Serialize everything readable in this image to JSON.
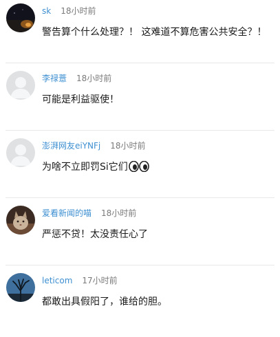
{
  "comments": [
    {
      "username": "sk",
      "time": "18小时前",
      "content": "警告算个什么处理？！ 这难道不算危害公共安全？！",
      "avatar_icon": "night-scene-avatar"
    },
    {
      "username": "李禄薏",
      "time": "18小时前",
      "content": "可能是利益驱使！",
      "avatar_icon": "default-user-avatar"
    },
    {
      "username": "澎湃网友eiYNFj",
      "time": "18小时前",
      "content": "为啥不立即罚Si它们",
      "emoji": "eyes-emoji",
      "avatar_icon": "default-user-avatar"
    },
    {
      "username": "爱看新闻的喵",
      "time": "18小时前",
      "content": "严惩不贷！太没责任心了",
      "avatar_icon": "cat-photo-avatar"
    },
    {
      "username": "leticom",
      "time": "17小时前",
      "content": "都敢出具假阳了，谁给的胆。",
      "avatar_icon": "tree-silhouette-avatar"
    }
  ]
}
